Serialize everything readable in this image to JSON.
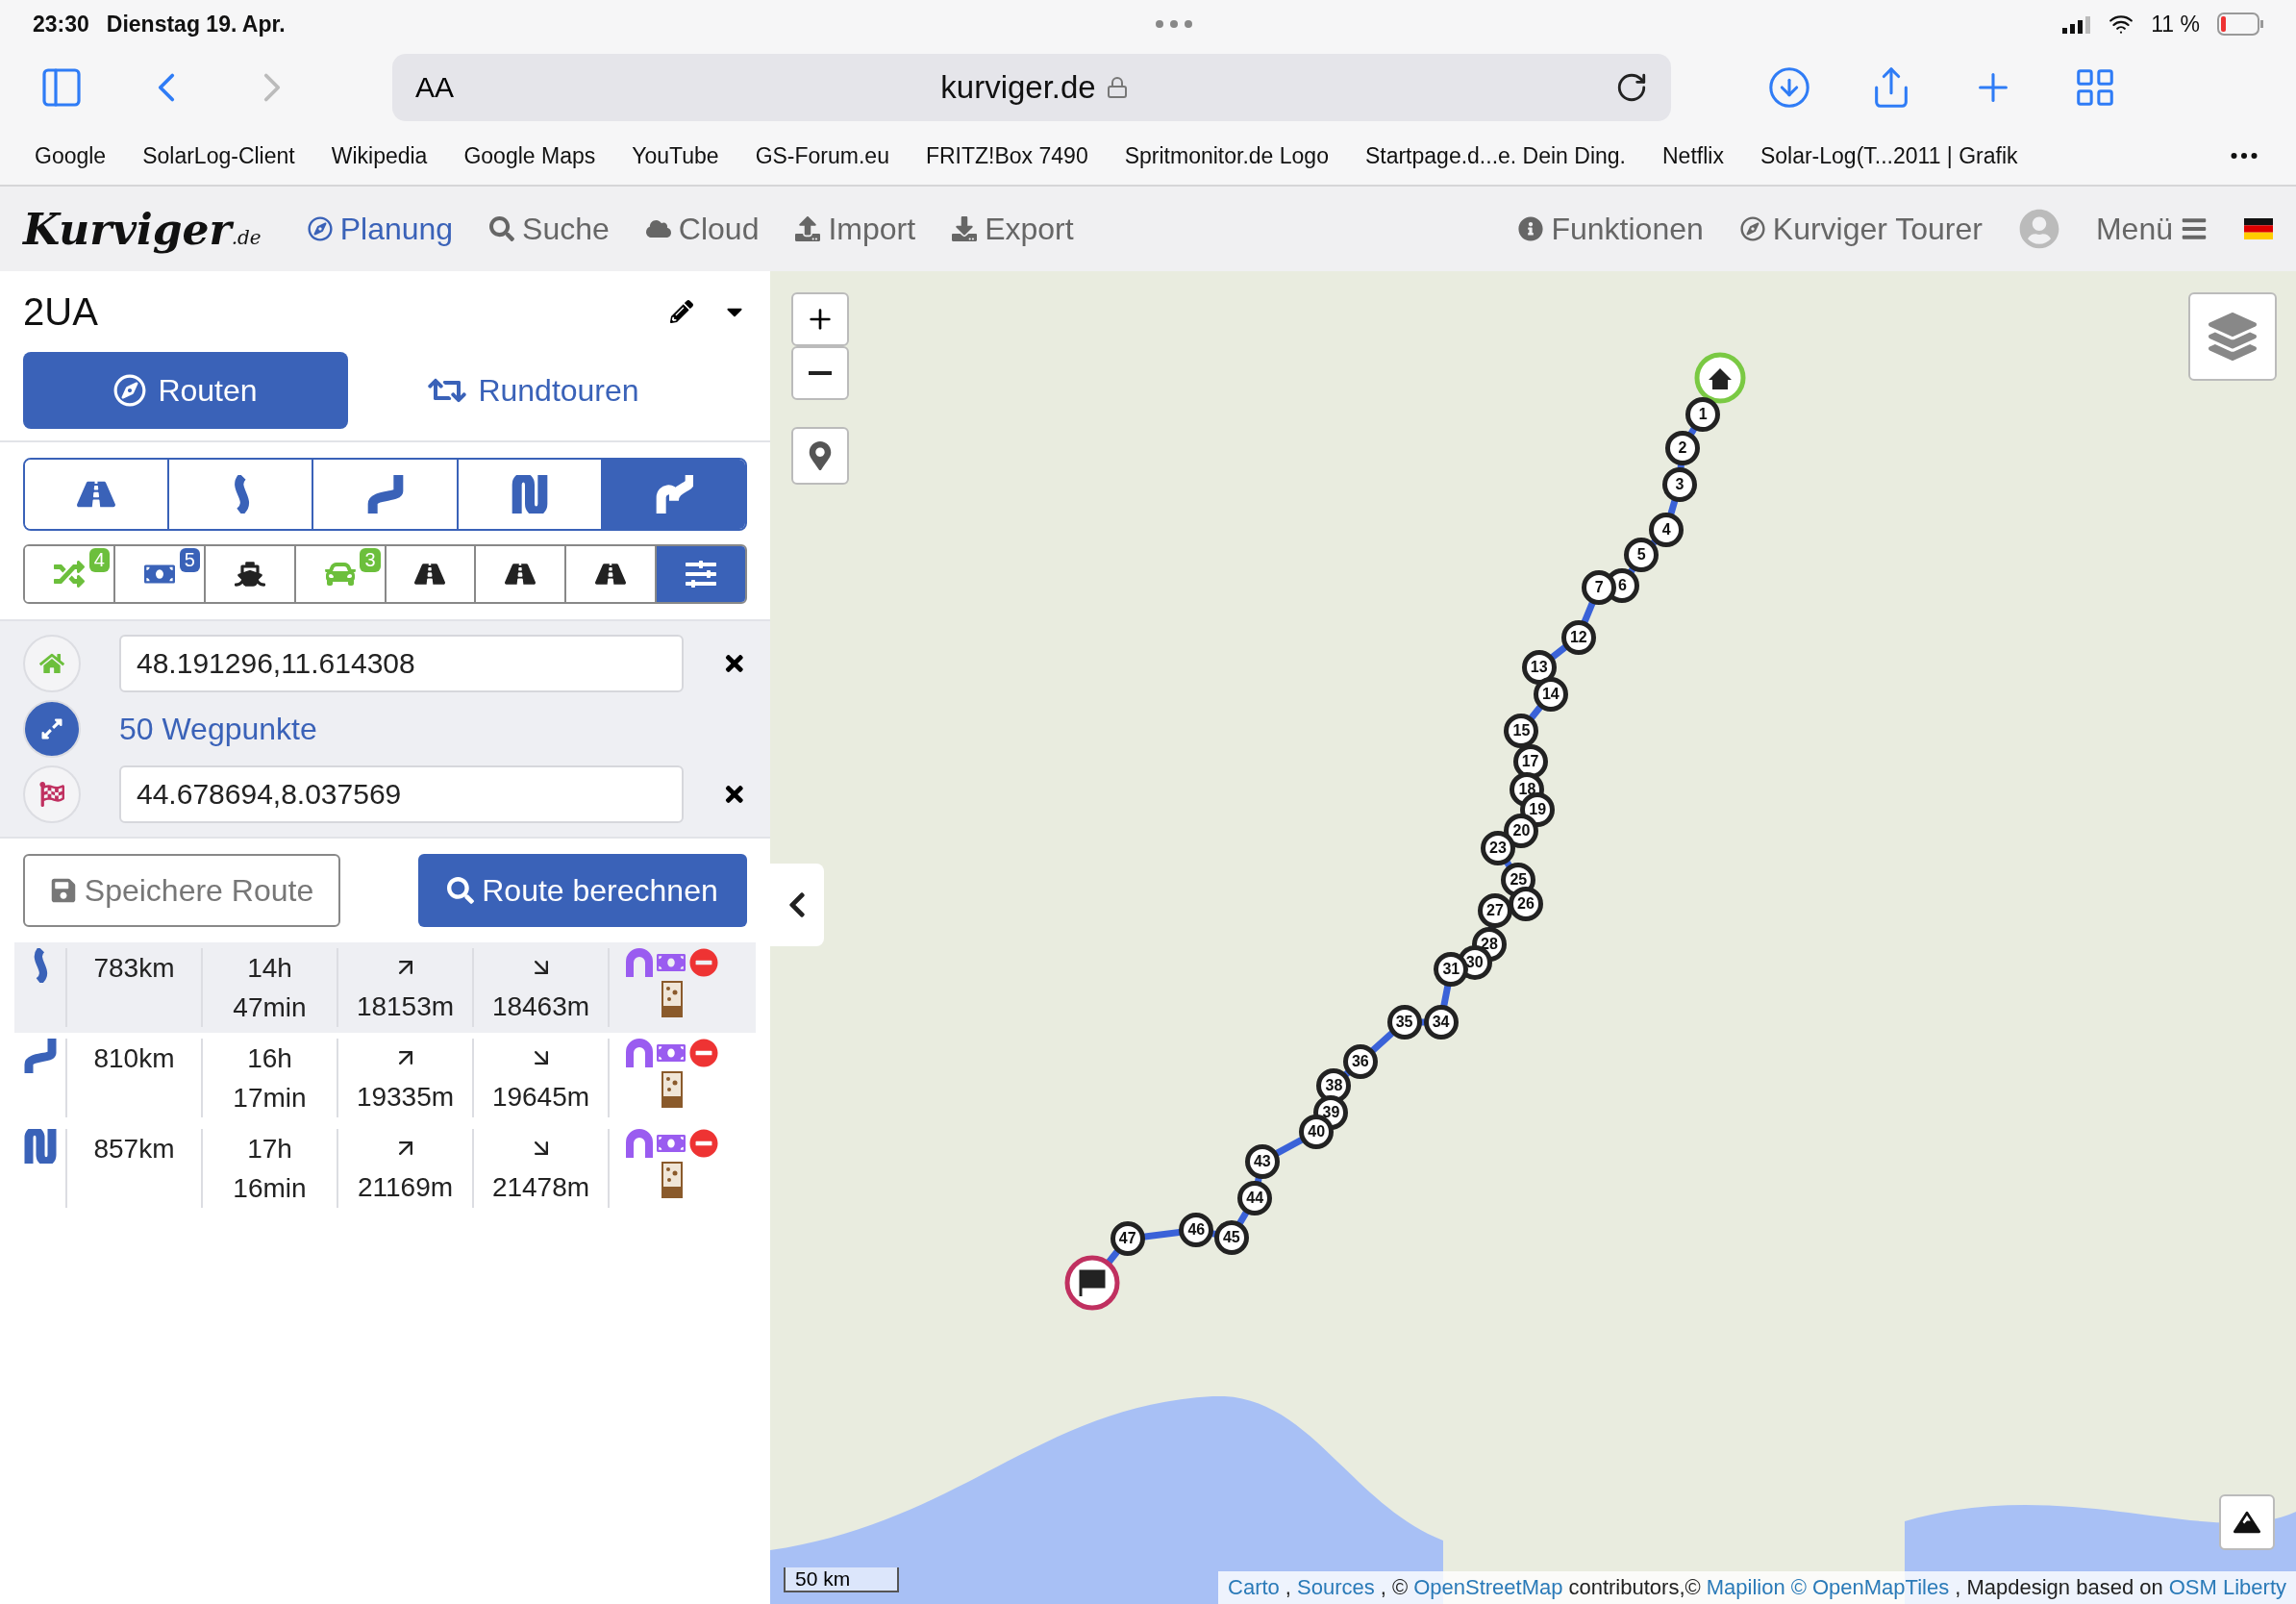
{
  "status_bar": {
    "time": "23:30",
    "date": "Dienstag 19. Apr.",
    "battery": "11 %"
  },
  "browser": {
    "text_size": "AA",
    "url": "kurviger.de",
    "forward_disabled": true
  },
  "bookmarks": [
    "Google",
    "SolarLog-Client",
    "Wikipedia",
    "Google Maps",
    "YouTube",
    "GS-Forum.eu",
    "FRITZ!Box 7490",
    "Spritmonitor.de Logo",
    "Startpage.d...e. Dein Ding.",
    "Netflix",
    "Solar-Log(T...2011 | Grafik"
  ],
  "navbar": {
    "logo": "Kurviger",
    "logo_suffix": ".de",
    "items": [
      {
        "kind": "plan",
        "label": "Planung",
        "selected": true
      },
      {
        "kind": "search",
        "label": "Suche",
        "selected": false
      },
      {
        "kind": "cloud",
        "label": "Cloud",
        "selected": false
      },
      {
        "kind": "import",
        "label": "Import",
        "selected": false
      },
      {
        "kind": "export",
        "label": "Export",
        "selected": false
      }
    ],
    "right_items": [
      {
        "kind": "info",
        "label": "Funktionen"
      },
      {
        "kind": "tourer",
        "label": "Kurviger Tourer"
      },
      {
        "kind": "menu",
        "label": "Menü"
      }
    ]
  },
  "planner": {
    "title": "2UA",
    "tabs": [
      {
        "kind": "routes",
        "label": "Routen",
        "selected": true
      },
      {
        "kind": "round",
        "label": "Rundtouren",
        "selected": false
      }
    ],
    "route_types": [
      {
        "kind": "fastest",
        "selected": false
      },
      {
        "kind": "curvy",
        "selected": false
      },
      {
        "kind": "curvier",
        "selected": false
      },
      {
        "kind": "extra",
        "selected": false
      },
      {
        "kind": "super",
        "selected": true
      }
    ],
    "options": [
      {
        "kind": "shuffle",
        "color": "#6cbf3c",
        "badge": "4",
        "selected": false
      },
      {
        "kind": "toll",
        "color": "#3a62b8",
        "badge": "5",
        "selected": false
      },
      {
        "kind": "ferry",
        "color": "#222222",
        "selected": false
      },
      {
        "kind": "car",
        "color": "#6cbf3c",
        "badge": "3",
        "selected": false
      },
      {
        "kind": "road",
        "color": "#222222",
        "selected": false
      },
      {
        "kind": "narrow",
        "color": "#222222",
        "selected": false
      },
      {
        "kind": "unpaved",
        "color": "#222222",
        "selected": false
      },
      {
        "kind": "settings",
        "color": "#ffffff",
        "selected": true
      }
    ],
    "start": "48.191296,11.614308",
    "waypoints_link": "50 Wegpunkte",
    "end": "44.678694,8.037569",
    "save_button": "Speichere Route",
    "calc_button": "Route berechnen",
    "results": [
      {
        "kind": "curvy",
        "distance": "783km",
        "time": "14h 47min",
        "ascent": "18153m",
        "descent": "18463m",
        "selected": true
      },
      {
        "kind": "curvier",
        "distance": "810km",
        "time": "16h 17min",
        "ascent": "19335m",
        "descent": "19645m",
        "selected": false
      },
      {
        "kind": "extra",
        "distance": "857km",
        "time": "17h 16min",
        "ascent": "21169m",
        "descent": "21478m",
        "selected": false
      }
    ]
  },
  "map": {
    "markers": [
      "1",
      "2",
      "3",
      "4",
      "5",
      "6",
      "7",
      "12",
      "13",
      "14",
      "15",
      "17",
      "18",
      "19",
      "20",
      "23",
      "25",
      "26",
      "27",
      "28",
      "30",
      "31",
      "34",
      "35",
      "36",
      "38",
      "39",
      "40",
      "43",
      "44",
      "45",
      "46",
      "47"
    ],
    "scale": "50 km",
    "attribution": [
      {
        "kind": "link",
        "text": "Carto"
      },
      {
        "kind": "text",
        "text": ","
      },
      {
        "kind": "link",
        "text": "Sources"
      },
      {
        "kind": "text",
        "text": ", ©"
      },
      {
        "kind": "link",
        "text": "OpenStreetMap"
      },
      {
        "kind": "text",
        "text": "contributors,©"
      },
      {
        "kind": "link",
        "text": "Mapilion"
      },
      {
        "kind": "link",
        "text": "© OpenMapTiles"
      },
      {
        "kind": "text",
        "text": ", Mapdesign based on"
      },
      {
        "kind": "link",
        "text": "OSM Liberty"
      }
    ]
  }
}
